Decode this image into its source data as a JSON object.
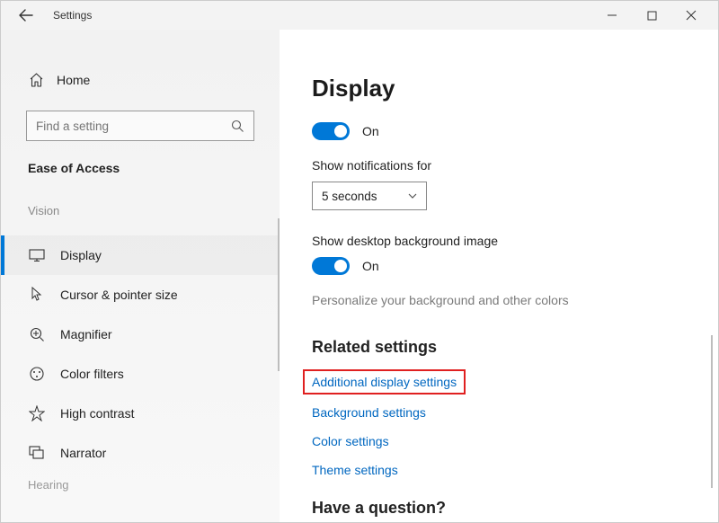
{
  "titlebar": {
    "title": "Settings"
  },
  "sidebar": {
    "home": "Home",
    "search_placeholder": "Find a setting",
    "category": "Ease of Access",
    "group_vision": "Vision",
    "items": [
      {
        "label": "Display"
      },
      {
        "label": "Cursor & pointer size"
      },
      {
        "label": "Magnifier"
      },
      {
        "label": "Color filters"
      },
      {
        "label": "High contrast"
      },
      {
        "label": "Narrator"
      }
    ],
    "group_hearing": "Hearing"
  },
  "main": {
    "title": "Display",
    "toggle1_state": "On",
    "notif_label": "Show notifications for",
    "notif_value": "5 seconds",
    "desktop_bg_label": "Show desktop background image",
    "toggle2_state": "On",
    "personalize_hint": "Personalize your background and other colors",
    "related_title": "Related settings",
    "links": [
      "Additional display settings",
      "Background settings",
      "Color settings",
      "Theme settings"
    ],
    "question": "Have a question?"
  }
}
